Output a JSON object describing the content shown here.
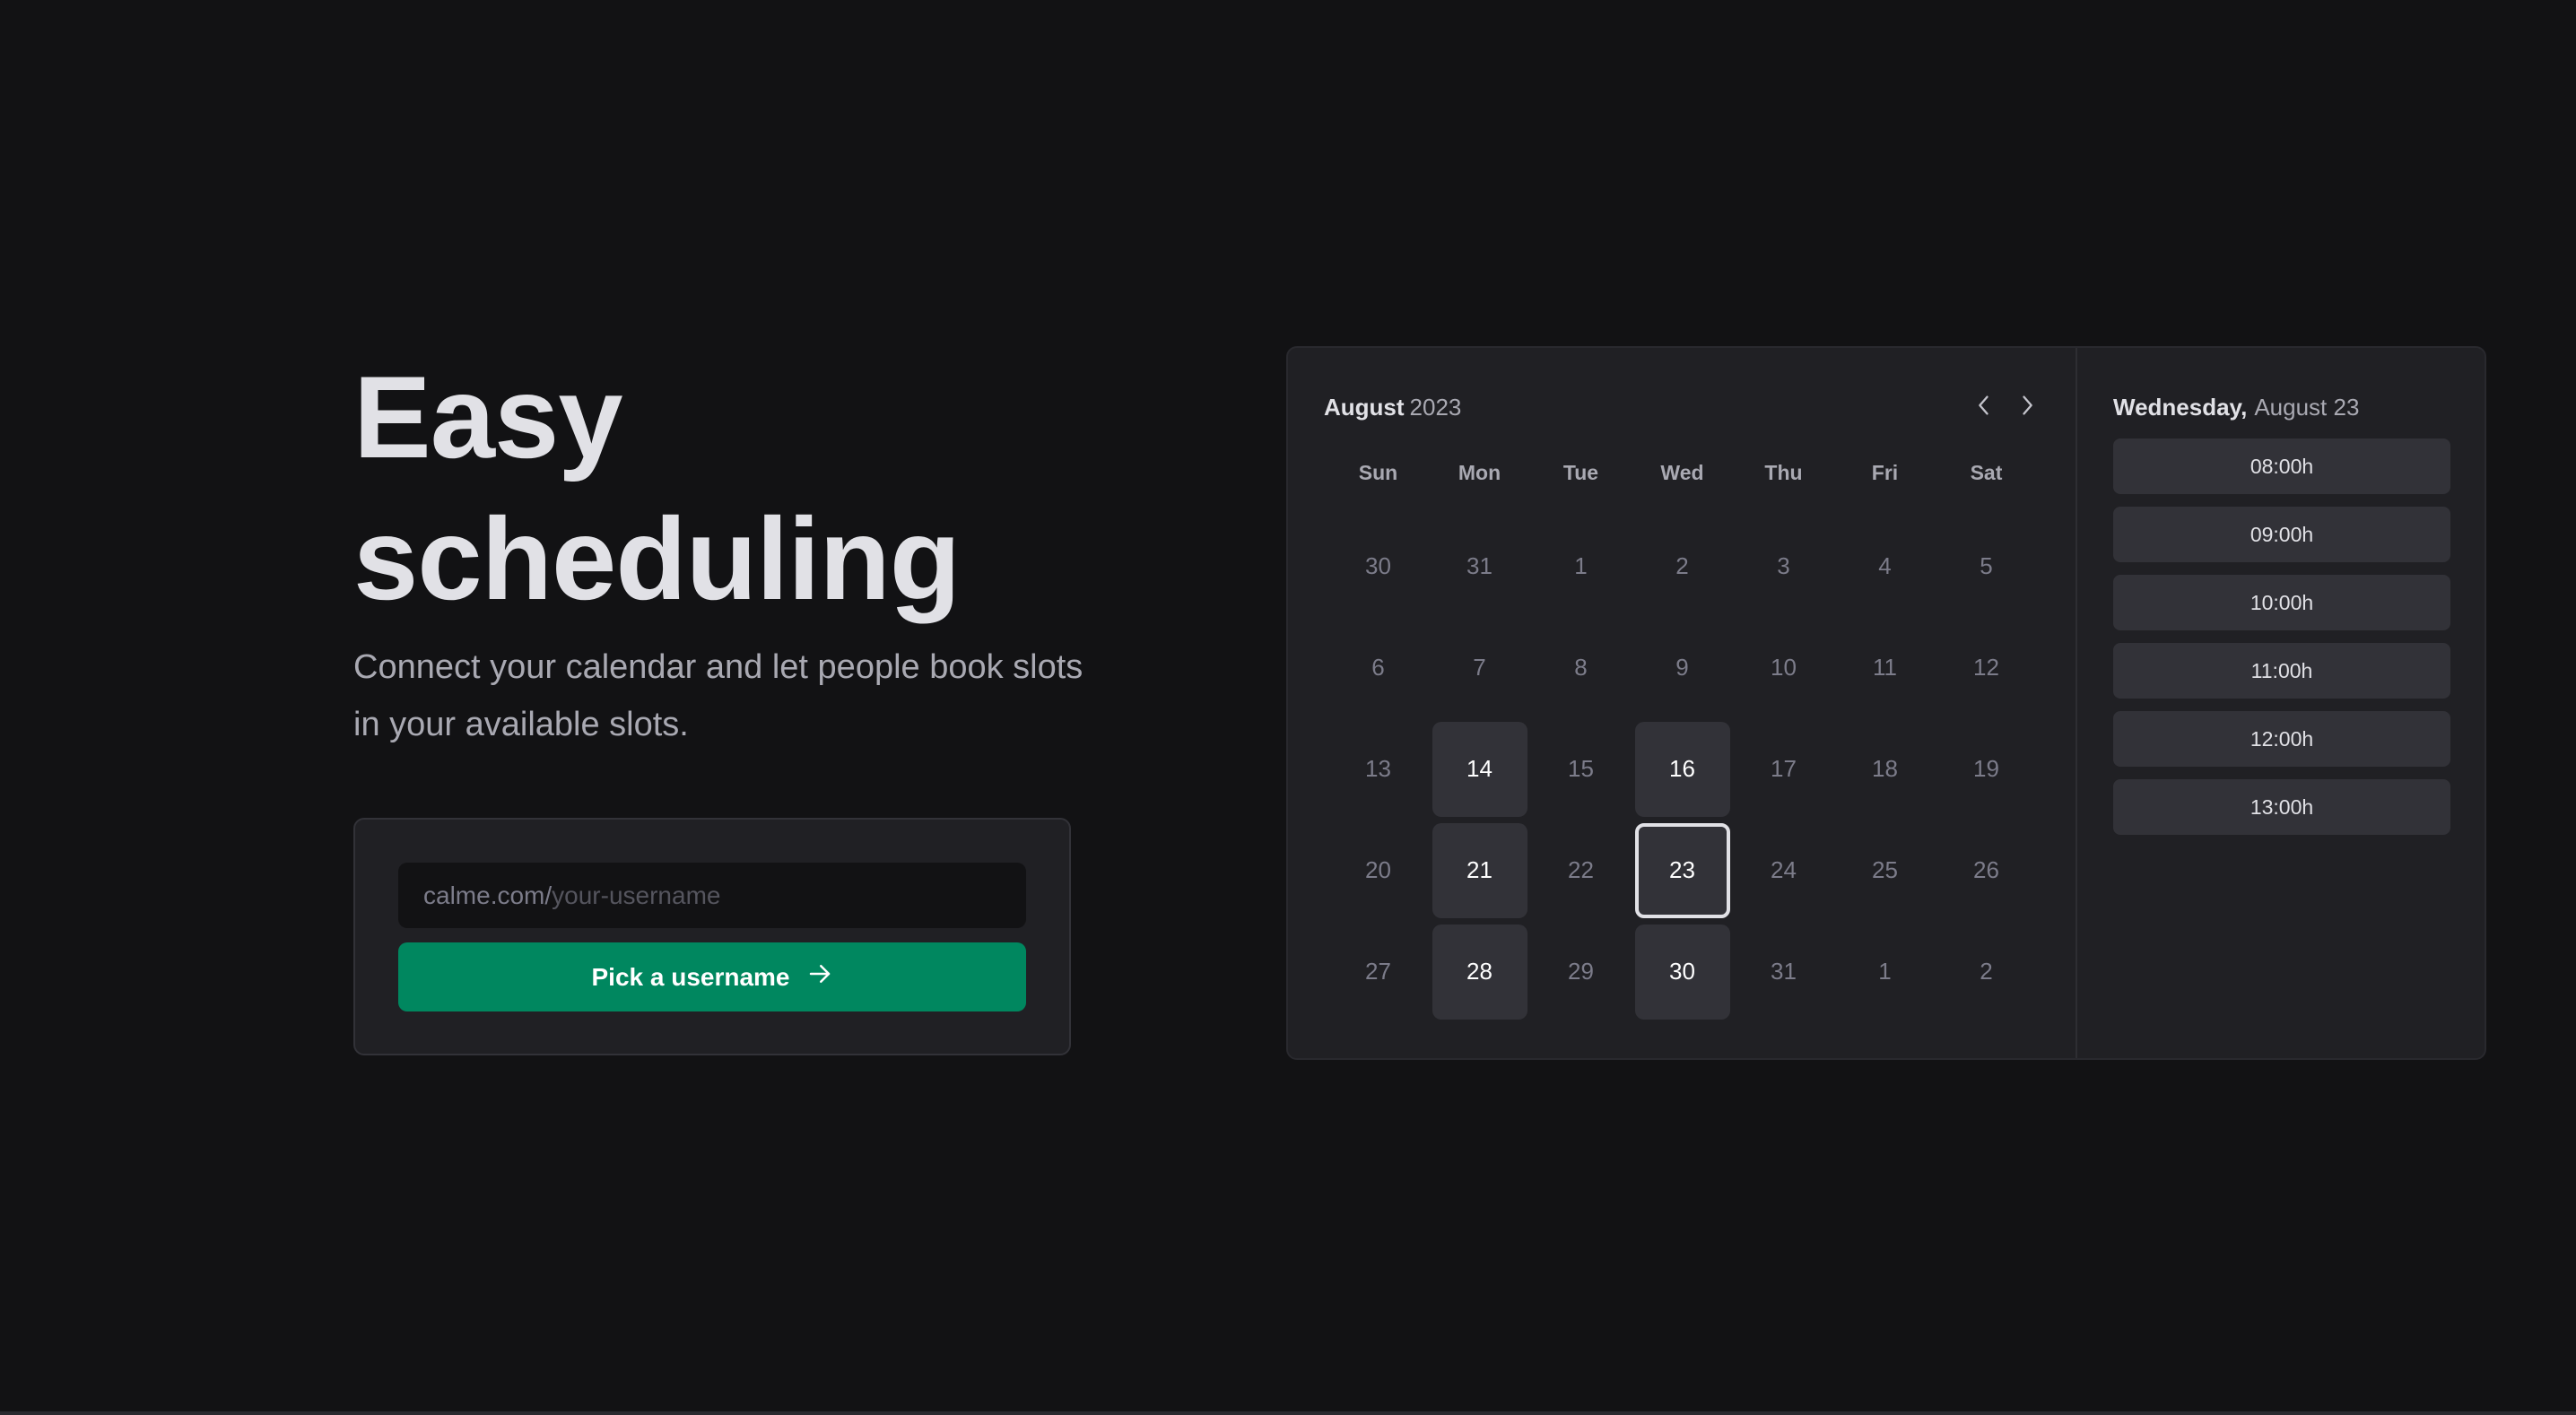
{
  "hero": {
    "title_line1": "Easy",
    "title_line2": "scheduling",
    "subtitle": "Connect your calendar and let people book slots in your available slots."
  },
  "claim_form": {
    "input_prefix": "calme.com/",
    "input_placeholder": "your-username",
    "input_value": "",
    "button_label": "Pick a username",
    "button_icon": "arrow-right-icon"
  },
  "calendar": {
    "month": "August",
    "year": "2023",
    "prev_icon": "chevron-left-icon",
    "next_icon": "chevron-right-icon",
    "weekdays": [
      "Sun",
      "Mon",
      "Tue",
      "Wed",
      "Thu",
      "Fri",
      "Sat"
    ],
    "weeks": [
      [
        {
          "d": "30",
          "state": "disabled"
        },
        {
          "d": "31",
          "state": "disabled"
        },
        {
          "d": "1",
          "state": "disabled"
        },
        {
          "d": "2",
          "state": "disabled"
        },
        {
          "d": "3",
          "state": "disabled"
        },
        {
          "d": "4",
          "state": "disabled"
        },
        {
          "d": "5",
          "state": "disabled"
        }
      ],
      [
        {
          "d": "6",
          "state": "disabled"
        },
        {
          "d": "7",
          "state": "disabled"
        },
        {
          "d": "8",
          "state": "disabled"
        },
        {
          "d": "9",
          "state": "disabled"
        },
        {
          "d": "10",
          "state": "disabled"
        },
        {
          "d": "11",
          "state": "disabled"
        },
        {
          "d": "12",
          "state": "disabled"
        }
      ],
      [
        {
          "d": "13",
          "state": "disabled"
        },
        {
          "d": "14",
          "state": "available"
        },
        {
          "d": "15",
          "state": "disabled"
        },
        {
          "d": "16",
          "state": "available"
        },
        {
          "d": "17",
          "state": "disabled"
        },
        {
          "d": "18",
          "state": "disabled"
        },
        {
          "d": "19",
          "state": "disabled"
        }
      ],
      [
        {
          "d": "20",
          "state": "disabled"
        },
        {
          "d": "21",
          "state": "available"
        },
        {
          "d": "22",
          "state": "disabled"
        },
        {
          "d": "23",
          "state": "selected"
        },
        {
          "d": "24",
          "state": "disabled"
        },
        {
          "d": "25",
          "state": "disabled"
        },
        {
          "d": "26",
          "state": "disabled"
        }
      ],
      [
        {
          "d": "27",
          "state": "disabled"
        },
        {
          "d": "28",
          "state": "available"
        },
        {
          "d": "29",
          "state": "disabled"
        },
        {
          "d": "30",
          "state": "available"
        },
        {
          "d": "31",
          "state": "disabled"
        },
        {
          "d": "1",
          "state": "disabled"
        },
        {
          "d": "2",
          "state": "disabled"
        }
      ]
    ]
  },
  "time_picker": {
    "weekday": "Wednesday,",
    "date": "August 23",
    "slots": [
      "08:00h",
      "09:00h",
      "10:00h",
      "11:00h",
      "12:00h",
      "13:00h"
    ]
  },
  "colors": {
    "background": "#121214",
    "card": "#202024",
    "accent": "#00875f",
    "available_day": "#323238"
  }
}
